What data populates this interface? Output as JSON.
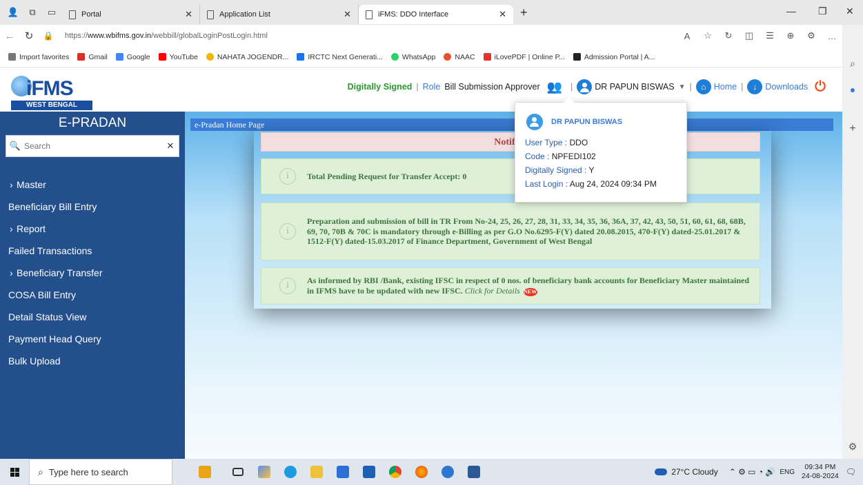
{
  "browser": {
    "tabs": [
      {
        "title": "Portal",
        "active": false
      },
      {
        "title": "Application List",
        "active": false
      },
      {
        "title": "iFMS: DDO Interface",
        "active": true
      }
    ],
    "url_prefix": "https://",
    "url_host": "www.wbifms.gov.in",
    "url_path": "/webbill/globalLoginPostLogin.html",
    "favorites": [
      {
        "label": "Import favorites",
        "color": "#777777"
      },
      {
        "label": "Gmail",
        "color": "#d93025"
      },
      {
        "label": "Google",
        "color": "#4285f4"
      },
      {
        "label": "YouTube",
        "color": "#ff0000"
      },
      {
        "label": "NAHATA JOGENDR...",
        "color": "#f4b400"
      },
      {
        "label": "IRCTC Next Generati...",
        "color": "#1a73e8"
      },
      {
        "label": "WhatsApp",
        "color": "#25d366"
      },
      {
        "label": "NAAC",
        "color": "#e5532d"
      },
      {
        "label": "iLovePDF | Online P...",
        "color": "#e5322d"
      },
      {
        "label": "Admission Portal | A...",
        "color": "#222222"
      }
    ]
  },
  "header": {
    "logo_text": "iFMS",
    "logo_sub": "WEST BENGAL",
    "digitally_signed": "Digitally Signed",
    "sep": "|",
    "role_label": "Role",
    "role_value": "Bill Submission Approver",
    "user_name": "DR PAPUN BISWAS",
    "home_label": "Home",
    "downloads_label": "Downloads"
  },
  "sidebar": {
    "title": "E-PRADAN",
    "search_placeholder": "Search",
    "items": [
      {
        "label": "Master",
        "expandable": true
      },
      {
        "label": "Beneficiary Bill Entry",
        "expandable": false
      },
      {
        "label": "Report",
        "expandable": true
      },
      {
        "label": "Failed Transactions",
        "expandable": false
      },
      {
        "label": "Beneficiary Transfer",
        "expandable": true
      },
      {
        "label": "COSA Bill Entry",
        "expandable": false
      },
      {
        "label": "Detail Status View",
        "expandable": false
      },
      {
        "label": "Payment Head Query",
        "expandable": false
      },
      {
        "label": "Bulk Upload",
        "expandable": false
      }
    ]
  },
  "main": {
    "home_strip": "e-Pradan Home Page",
    "notif_title": "Notifica",
    "alerts": [
      {
        "text": "Total Pending Request for Transfer Accept: 0"
      },
      {
        "text": "Preparation and submission of bill in TR From No-24, 25, 26, 27, 28, 31, 33, 34, 35, 36, 36A, 37, 42, 43, 50, 51, 60, 61, 68, 68B, 69, 70, 70B & 70C is mandatory through e-Billing as per G.O No.6295-F(Y) dated 20.08.2015, 470-F(Y) dated-25.01.2017 & 1512-F(Y) dated-15.03.2017 of Finance Department, Government of West Bengal"
      },
      {
        "text": "As informed by RBI /Bank, existing IFSC in respect of  0 nos. of beneficiary bank accounts for Beneficiary Master maintained in IFMS have to be updated with new IFSC.",
        "link": "Click for Details",
        "badge": "NEW"
      }
    ]
  },
  "popup": {
    "name": "DR PAPUN BISWAS",
    "user_type_label": "User Type :",
    "user_type": "DDO",
    "code_label": "Code :",
    "code": "NPFEDI102",
    "signed_label": "Digitally Signed :",
    "signed": "Y",
    "last_login_label": "Last Login :",
    "last_login": "Aug 24, 2024 09:34 PM"
  },
  "taskbar": {
    "search_placeholder": "Type here to search",
    "weather": "27°C  Cloudy",
    "lang": "ENG",
    "time": "09:34 PM",
    "date": "24-08-2024"
  }
}
